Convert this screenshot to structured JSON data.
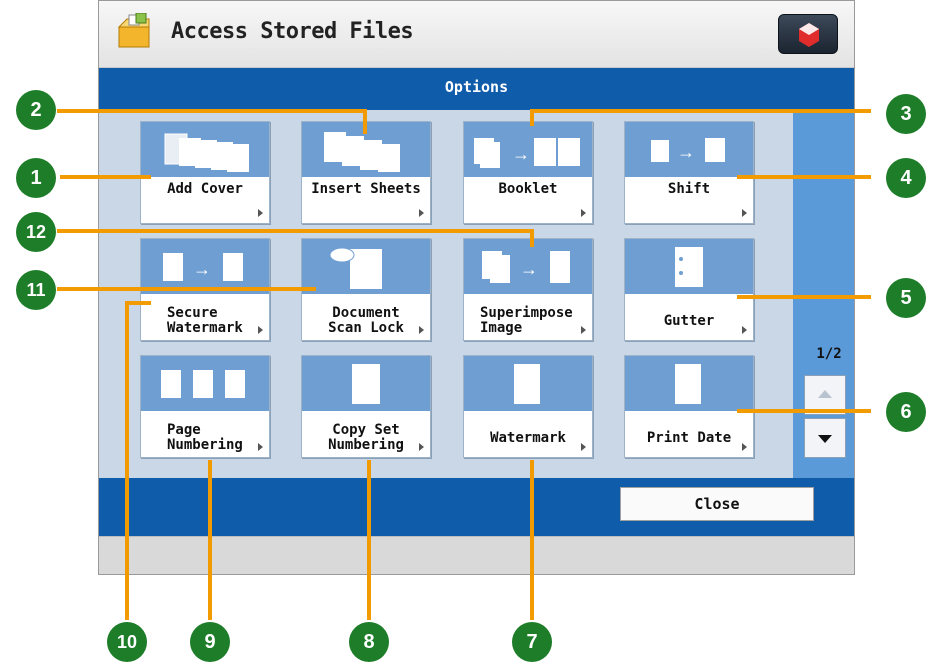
{
  "header": {
    "title": "Access Stored Files"
  },
  "options_bar": {
    "label": "Options"
  },
  "buttons": [
    {
      "label": "Add Cover"
    },
    {
      "label": "Insert Sheets"
    },
    {
      "label": "Booklet"
    },
    {
      "label": "Shift"
    },
    {
      "label": "Secure\nWatermark"
    },
    {
      "label": "Document\nScan Lock"
    },
    {
      "label": "Superimpose\nImage"
    },
    {
      "label": "Gutter"
    },
    {
      "label": "Page\nNumbering"
    },
    {
      "label": "Copy Set\nNumbering"
    },
    {
      "label": "Watermark"
    },
    {
      "label": "Print Date"
    }
  ],
  "pager": {
    "current": "1/2"
  },
  "close_button": {
    "label": "Close"
  },
  "callouts": [
    "1",
    "2",
    "3",
    "4",
    "5",
    "6",
    "7",
    "8",
    "9",
    "10",
    "11",
    "12"
  ],
  "colors": {
    "accent_blue": "#0f5cab",
    "button_art": "#6f9fd2",
    "callout_green": "#1d7d29",
    "leader_orange": "#f29b00"
  }
}
